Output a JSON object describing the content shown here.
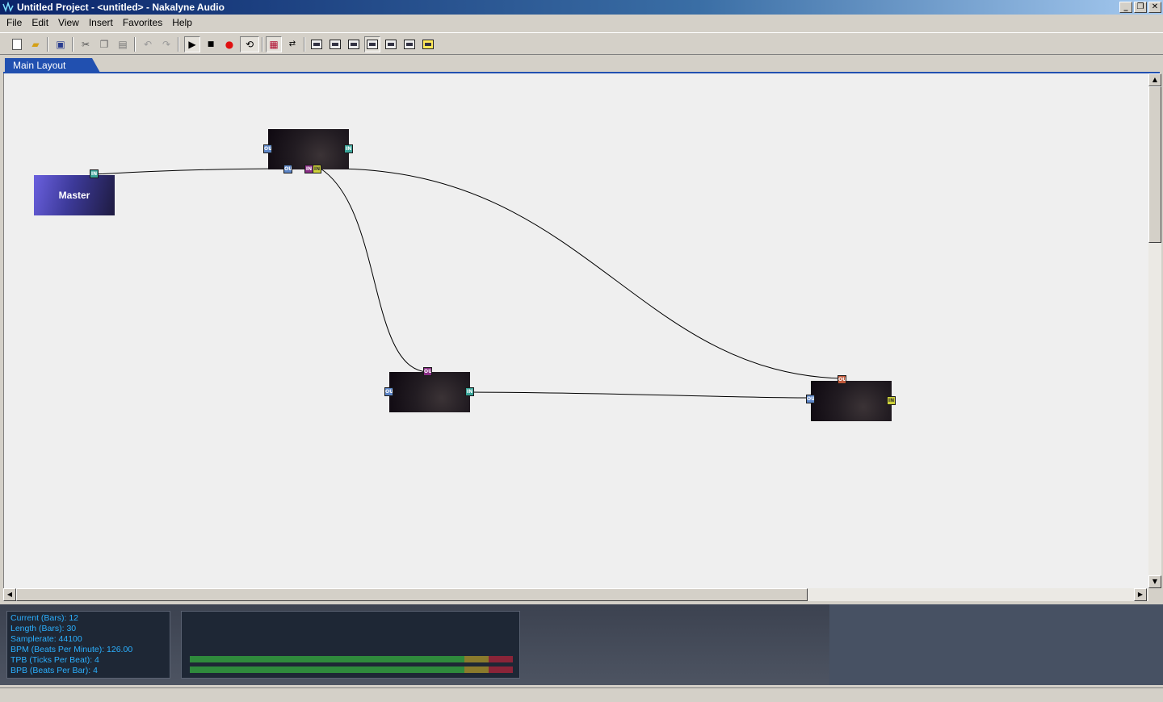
{
  "window": {
    "title": "Untitled Project - <untitled> - Nakalyne Audio",
    "controls": [
      "minimize",
      "restore",
      "close"
    ]
  },
  "menu": [
    "File",
    "Edit",
    "View",
    "Insert",
    "Favorites",
    "Help"
  ],
  "toolbar": {
    "buttons": [
      "new-file",
      "open-folder",
      "save",
      "cut",
      "copy",
      "paste",
      "undo",
      "redo",
      "play",
      "stop",
      "record",
      "loop",
      "mixer",
      "arrange",
      "view-1",
      "view-2",
      "view-3",
      "view-4",
      "view-5",
      "view-6",
      "view-7"
    ]
  },
  "tabs": [
    {
      "label": "Main Layout",
      "active": true
    }
  ],
  "nodes": {
    "master": {
      "label": "Master",
      "port": "IN"
    },
    "top": {
      "ports": [
        "OUT",
        "IN",
        "OUT",
        "IN",
        "IN"
      ]
    },
    "middle": {
      "ports": [
        "OUT",
        "OUT",
        "IN"
      ]
    },
    "right": {
      "ports": [
        "OUT",
        "OUT",
        "IN"
      ]
    }
  },
  "info": {
    "current": "Current (Bars): 12",
    "length": "Length (Bars): 30",
    "samplerate": "Samplerate: 44100",
    "bpm": "BPM (Beats Per Minute): 126.00",
    "tpb": "TPB (Ticks Per Beat): 4",
    "bpb": "BPB (Beats Per Bar): 4"
  },
  "colors": {
    "titlebar_start": "#0a246a",
    "titlebar_end": "#a6caf0",
    "tab_active": "#2150b0",
    "info_text": "#2bb0ff",
    "panel_bg": "#1e2735",
    "meter_green": "#2f8a3c",
    "meter_yellow": "#8a7a2c",
    "meter_red": "#8a2438"
  }
}
